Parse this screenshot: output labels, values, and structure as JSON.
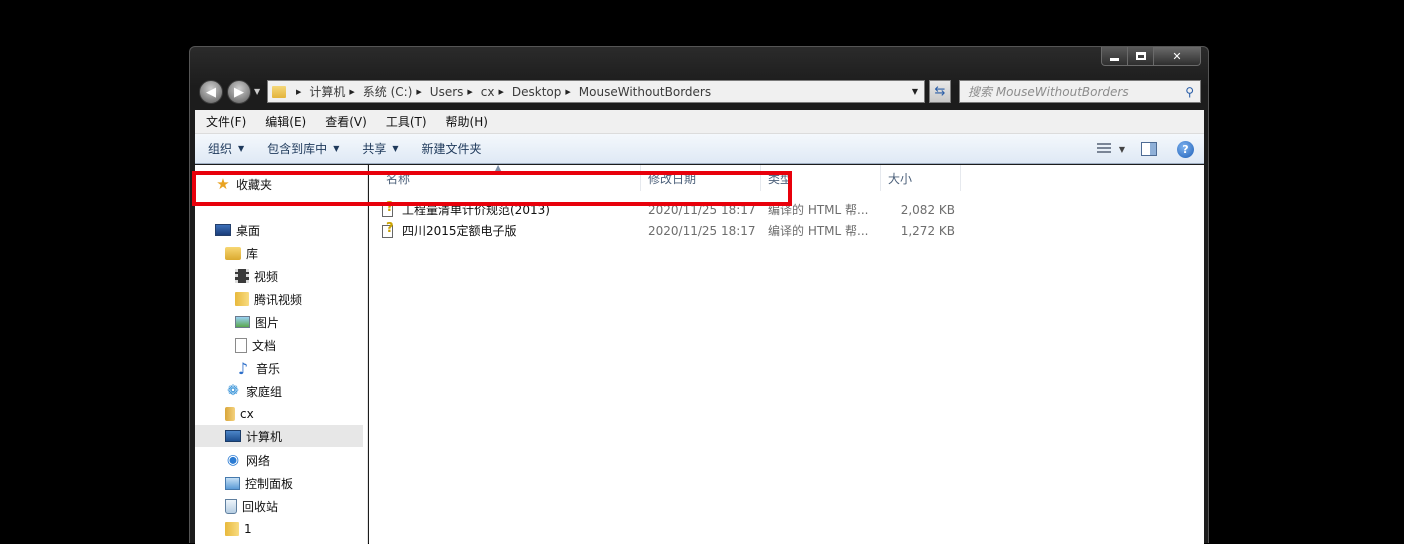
{
  "window": {
    "caption_buttons": [
      "minimize",
      "maximize",
      "close"
    ]
  },
  "address": {
    "crumbs": [
      "计算机",
      "系统 (C:)",
      "Users",
      "cx",
      "Desktop",
      "MouseWithoutBorders"
    ]
  },
  "search": {
    "placeholder": "搜索 MouseWithoutBorders"
  },
  "menu": {
    "items": [
      "文件(F)",
      "编辑(E)",
      "查看(V)",
      "工具(T)",
      "帮助(H)"
    ]
  },
  "commands": {
    "organize": "组织",
    "include_library": "包含到库中",
    "share": "共享",
    "new_folder": "新建文件夹"
  },
  "sidebar": {
    "items": [
      {
        "label": "收藏夹",
        "icon": "star-icon"
      },
      {
        "label": "桌面",
        "icon": "desktop-icon"
      },
      {
        "label": "库",
        "icon": "library-icon"
      },
      {
        "label": "视频",
        "icon": "video-icon"
      },
      {
        "label": "腾讯视频",
        "icon": "folder-icon"
      },
      {
        "label": "图片",
        "icon": "picture-icon"
      },
      {
        "label": "文档",
        "icon": "document-icon"
      },
      {
        "label": "音乐",
        "icon": "music-icon"
      },
      {
        "label": "家庭组",
        "icon": "homegroup-icon"
      },
      {
        "label": "cx",
        "icon": "user-folder-icon"
      },
      {
        "label": "计算机",
        "icon": "computer-icon"
      },
      {
        "label": "网络",
        "icon": "network-icon"
      },
      {
        "label": "控制面板",
        "icon": "control-panel-icon"
      },
      {
        "label": "回收站",
        "icon": "recycle-bin-icon"
      },
      {
        "label": "1",
        "icon": "folder-icon"
      }
    ],
    "selected": "计算机"
  },
  "columns": {
    "name": "名称",
    "modified": "修改日期",
    "type": "类型",
    "size": "大小"
  },
  "files": [
    {
      "name": "工程量清单计价规范(2013)",
      "modified": "2020/11/25 18:17",
      "type": "编译的 HTML 帮...",
      "size": "2,082 KB",
      "icon": "chm-help-icon"
    },
    {
      "name": "四川2015定额电子版",
      "modified": "2020/11/25 18:17",
      "type": "编译的 HTML 帮...",
      "size": "1,272 KB",
      "icon": "chm-help-icon"
    }
  ],
  "colors": {
    "highlight_box": "#e8000b",
    "window_frame": "#1c1c1c",
    "command_bar": "#dfe9f5"
  }
}
